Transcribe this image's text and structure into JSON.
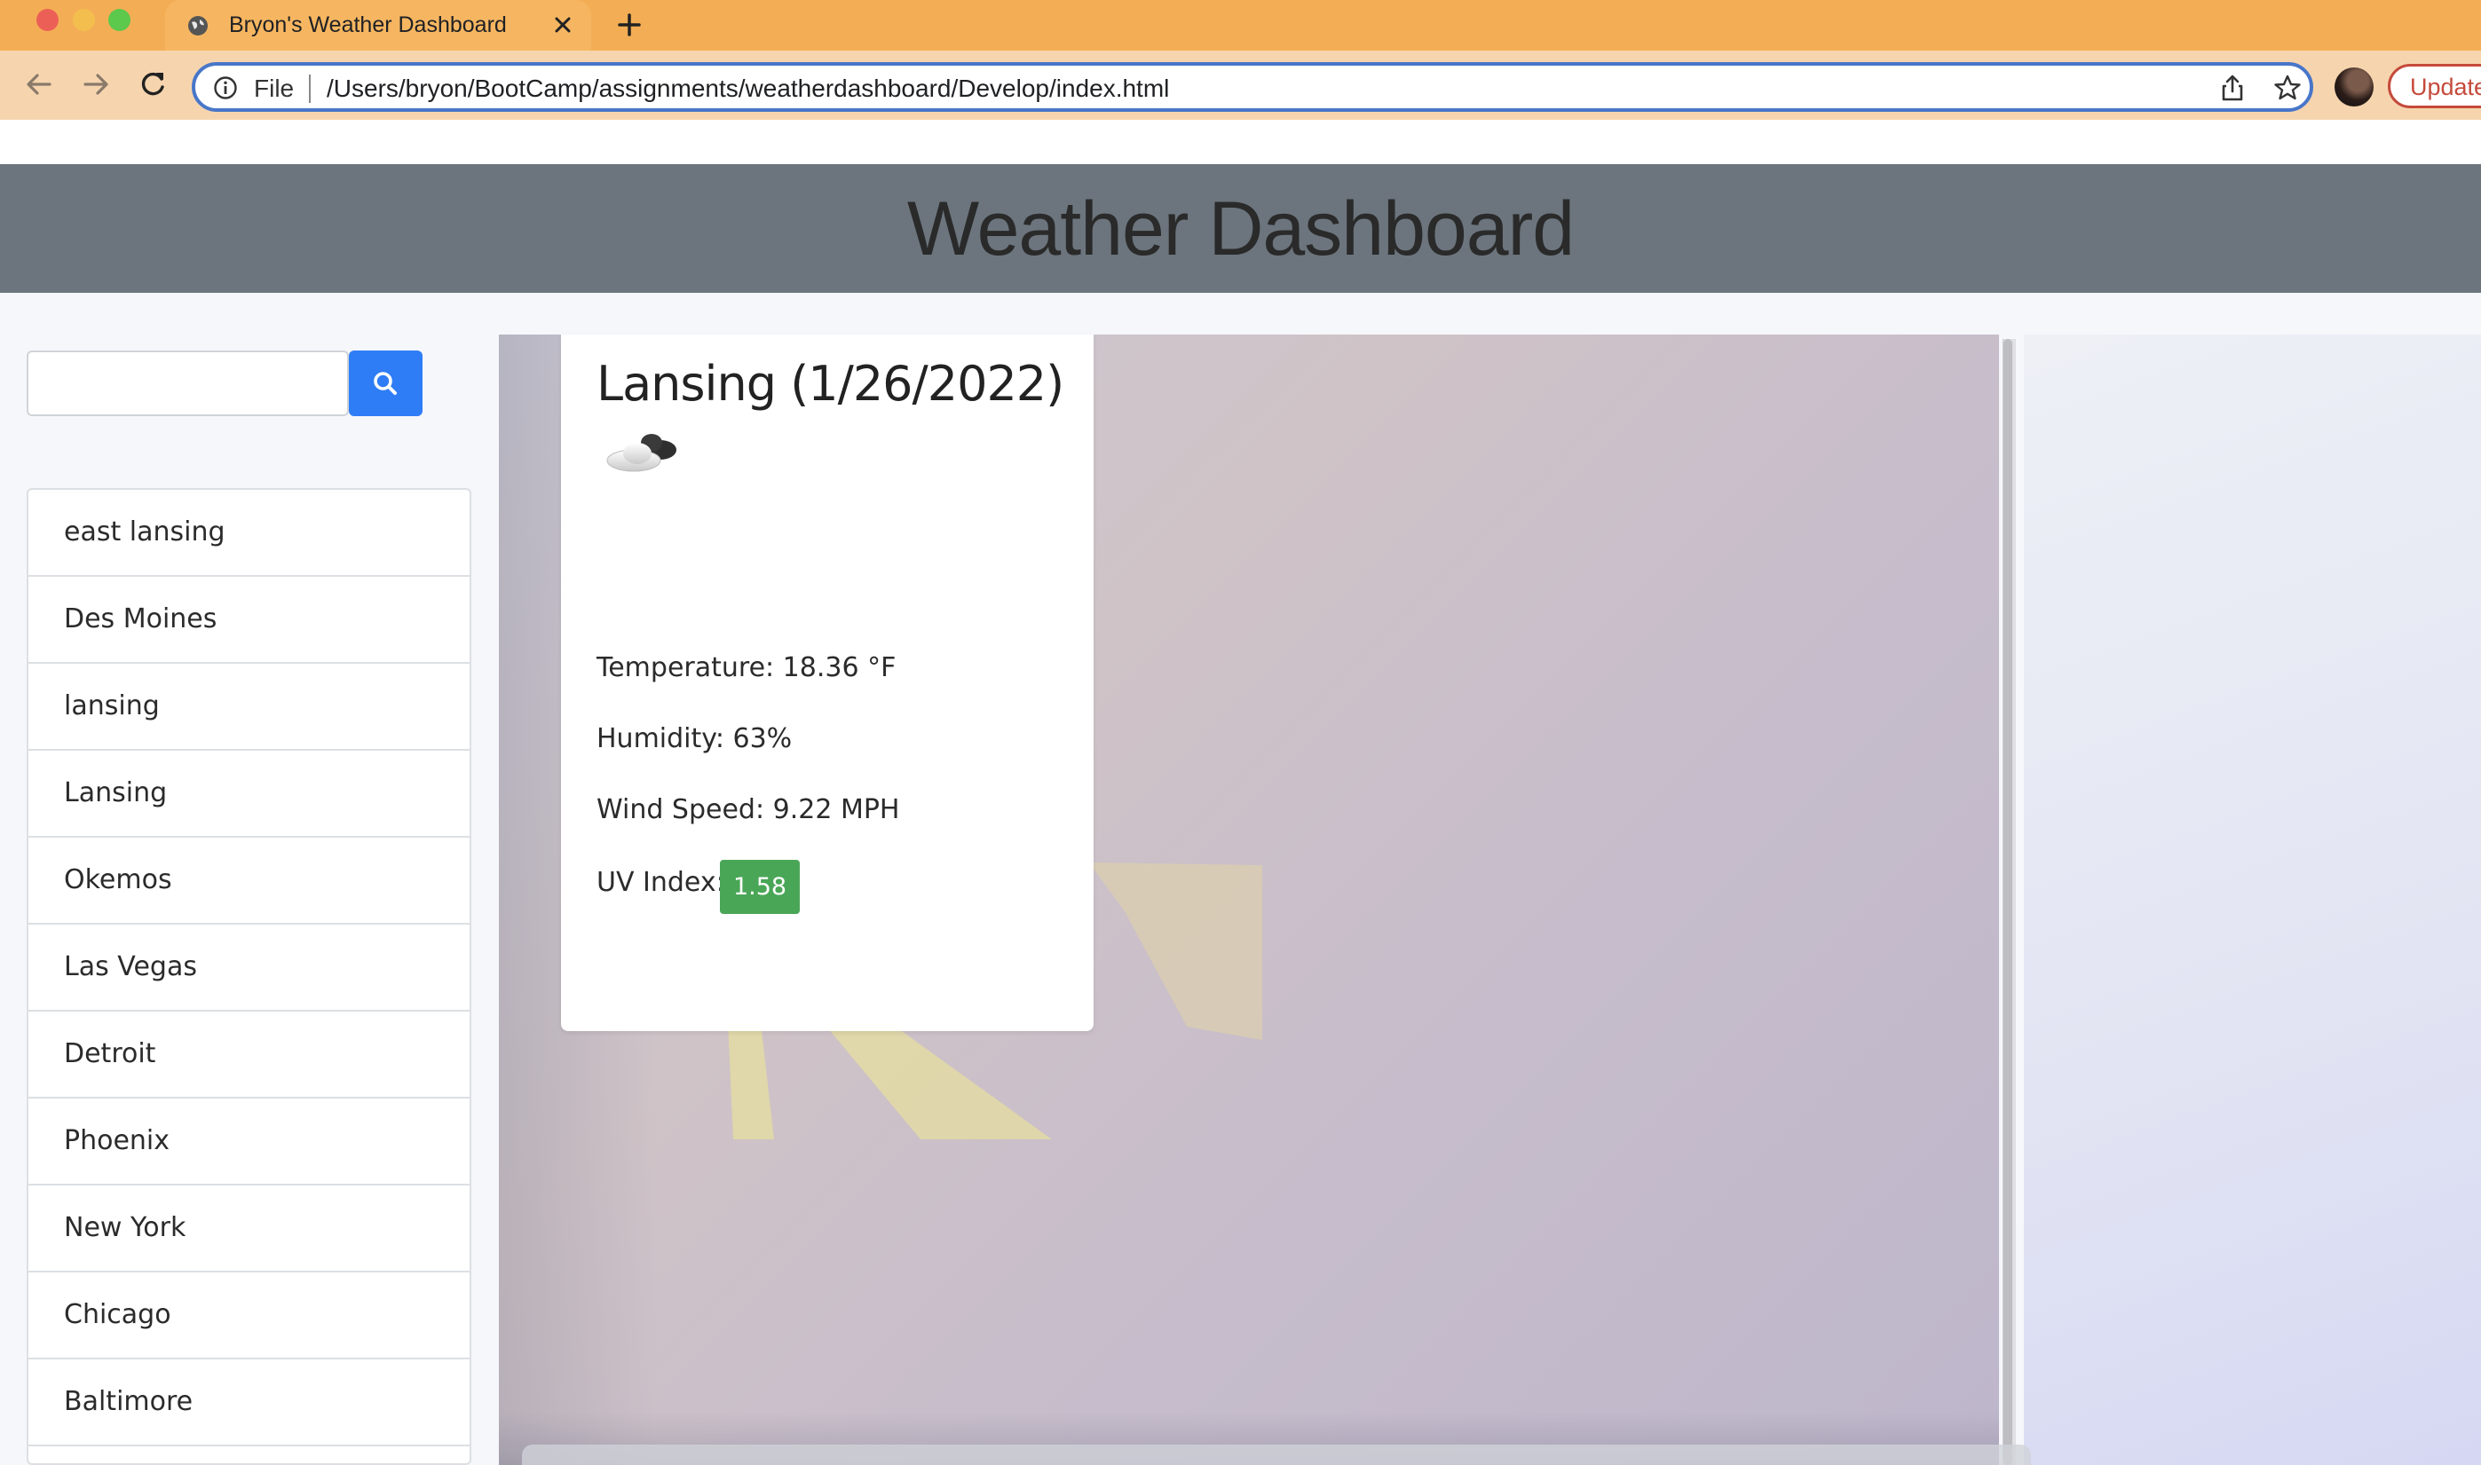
{
  "browser": {
    "tab_title": "Bryon's Weather Dashboard",
    "omnibox_prefix": "File",
    "url": "/Users/bryon/BootCamp/assignments/weatherdashboard/Develop/index.html",
    "update_label": "Update"
  },
  "page": {
    "heading": "Weather Dashboard",
    "search": {
      "value": "",
      "placeholder": ""
    },
    "history": [
      "east lansing",
      "Des Moines",
      "lansing",
      "Lansing",
      "Okemos",
      "Las Vegas",
      "Detroit",
      "Phoenix",
      "New York",
      "Chicago",
      "Baltimore"
    ],
    "current": {
      "title": "Lansing (1/26/2022)",
      "icon": "cloud-moon-icon",
      "temperature": "Temperature: 18.36 °F",
      "humidity": "Humidity: 63%",
      "wind": "Wind Speed: 9.22 MPH",
      "uv_label": "UV Index:",
      "uv_value": "1.58"
    }
  },
  "colors": {
    "tabbar": "#f3ae55",
    "hero": "#6c757d",
    "search_button": "#2f7df6",
    "uv_badge": "#4aa657"
  }
}
